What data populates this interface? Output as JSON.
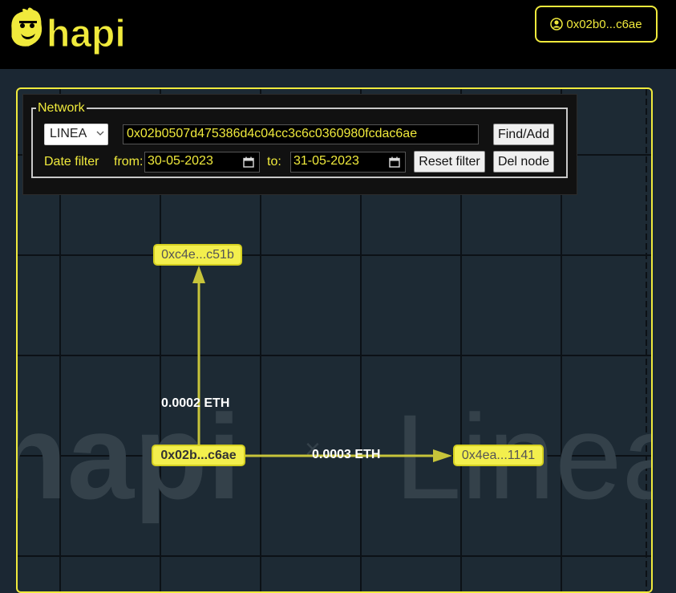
{
  "header": {
    "logo_text": "hapi",
    "wallet": {
      "icon": "user-circle-icon",
      "label": "0x02b0...c6ae"
    }
  },
  "controls": {
    "legend": "Network",
    "network_select": {
      "value": "LINEA"
    },
    "address_input": {
      "value": "0x02b0507d475386d4c04cc3c6c0360980fcdac6ae"
    },
    "find_add_label": "Find/Add",
    "date_filter_label": "Date  filter",
    "from_label": "from:",
    "from_value": "30-05-2023",
    "to_label": "to:",
    "to_value": "31-05-2023",
    "reset_filter_label": "Reset filter",
    "del_node_label": "Del node"
  },
  "graph": {
    "watermark": {
      "left": "hapi",
      "separator": "×",
      "right": "Linea"
    },
    "nodes": [
      {
        "label": "0xc4e...c51b"
      },
      {
        "label": "0x02b...c6ae"
      },
      {
        "label": "0x4ea...1141"
      }
    ],
    "edges": [
      {
        "label": "0.0002 ETH"
      },
      {
        "label": "0.0003 ETH"
      }
    ]
  },
  "colors": {
    "accent": "#f0ea3c",
    "node_fill": "#f3ef4d",
    "edge": "#c7c43a",
    "canvas_bg": "#1d2a34",
    "header_bg": "#000000"
  }
}
